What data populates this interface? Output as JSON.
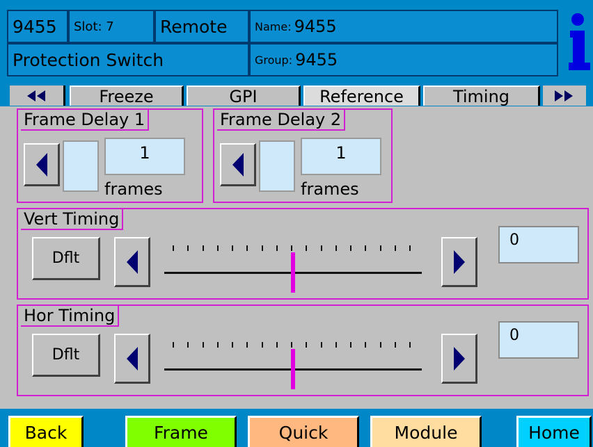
{
  "header": {
    "device_id": "9455",
    "slot": "Slot: 7",
    "mode": "Remote",
    "name_label": "Name:",
    "name_value": "9455",
    "function": "Protection Switch",
    "group_label": "Group:",
    "group_value": "9455",
    "info_icon": "info-icon"
  },
  "tabs": {
    "prev_icon": "double-left-arrow-icon",
    "items": [
      "Freeze",
      "GPI",
      "Reference",
      "Timing"
    ],
    "active": "Timing",
    "next_icon": "double-right-arrow-icon"
  },
  "frame_delay_1": {
    "label": "Frame Delay 1",
    "value": "1",
    "unit": "frames"
  },
  "frame_delay_2": {
    "label": "Frame Delay 2",
    "value": "1",
    "unit": "frames"
  },
  "vert_timing": {
    "label": "Vert Timing",
    "default_label": "Dflt",
    "value": "0",
    "slider_position": 0.5
  },
  "hor_timing": {
    "label": "Hor Timing",
    "default_label": "Dflt",
    "value": "0",
    "slider_position": 0.5
  },
  "bottom_bar": {
    "back": "Back",
    "frame": "Frame",
    "quick": "Quick",
    "module": "Module",
    "home": "Home"
  },
  "colors": {
    "header_bg": "#0087c8",
    "group_border": "#d020d0",
    "slider_thumb": "#e000e0",
    "back_btn": "#ffff00",
    "frame_btn": "#80ff00",
    "quick_btn": "#ffb880",
    "module_btn": "#ffdca0",
    "home_btn": "#00d0ff"
  }
}
